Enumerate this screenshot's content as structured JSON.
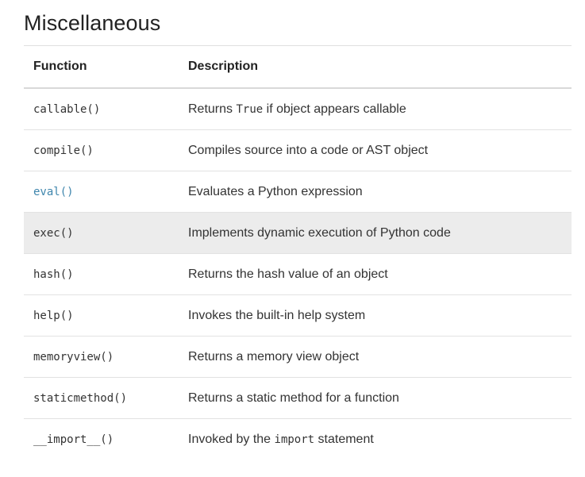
{
  "section": {
    "title": "Miscellaneous"
  },
  "table": {
    "headers": {
      "function": "Function",
      "description": "Description"
    },
    "rows": [
      {
        "function": "callable()",
        "description_before": "Returns ",
        "description_code": "True",
        "description_after": " if object appears callable",
        "is_link": false,
        "highlighted": false
      },
      {
        "function": "compile()",
        "description": "Compiles source into a code or AST object",
        "is_link": false,
        "highlighted": false
      },
      {
        "function": "eval()",
        "description": "Evaluates a Python expression",
        "is_link": true,
        "highlighted": false
      },
      {
        "function": "exec()",
        "description": "Implements dynamic execution of Python code",
        "is_link": false,
        "highlighted": true
      },
      {
        "function": "hash()",
        "description": "Returns the hash value of an object",
        "is_link": false,
        "highlighted": false
      },
      {
        "function": "help()",
        "description": "Invokes the built-in help system",
        "is_link": false,
        "highlighted": false
      },
      {
        "function": "memoryview()",
        "description": "Returns a memory view object",
        "is_link": false,
        "highlighted": false
      },
      {
        "function": "staticmethod()",
        "description": "Returns a static method for a function",
        "is_link": false,
        "highlighted": false
      },
      {
        "function": "__import__()",
        "description_before": "Invoked by the ",
        "description_code": "import",
        "description_after": " statement",
        "is_link": false,
        "highlighted": false
      }
    ]
  },
  "colors": {
    "link": "#3f86ad",
    "highlight_row": "#ececec",
    "text": "#222222"
  }
}
